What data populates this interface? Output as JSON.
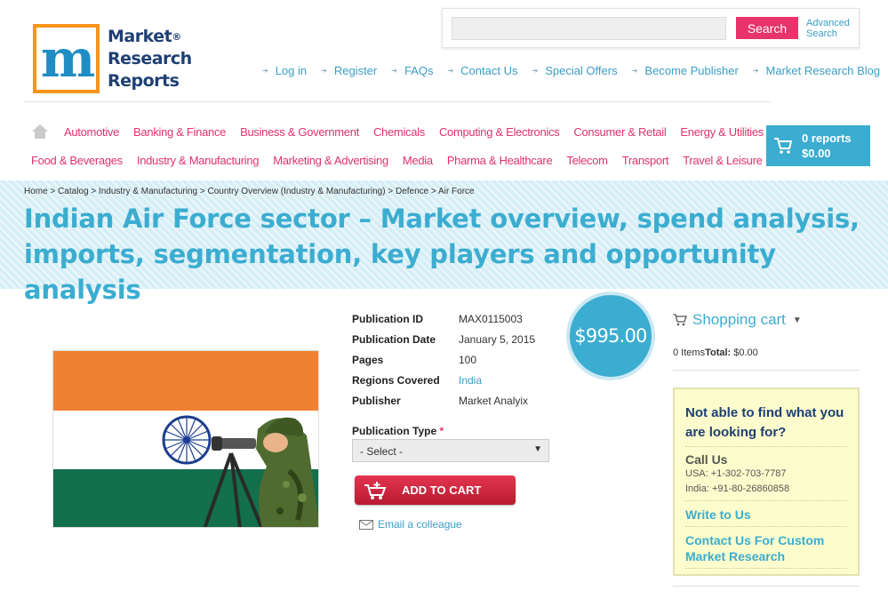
{
  "logo": {
    "text_line1": "Market",
    "text_line2": "Research",
    "text_line3": "Reports",
    "registered": "®"
  },
  "search": {
    "placeholder": "",
    "button_label": "Search",
    "advanced_line1": "Advanced",
    "advanced_line2": "Search"
  },
  "top_links": [
    "Log in",
    "Register",
    "FAQs",
    "Contact Us",
    "Special Offers",
    "Become Publisher",
    "Market Research Blog"
  ],
  "categories": {
    "row1": [
      "Automotive",
      "Banking & Finance",
      "Business & Government",
      "Chemicals",
      "Computing & Electronics",
      "Consumer & Retail",
      "Energy & Utilities"
    ],
    "row2": [
      "Food & Beverages",
      "Industry & Manufacturing",
      "Marketing & Advertising",
      "Media",
      "Pharma & Healthcare",
      "Telecom",
      "Transport",
      "Travel & Leisure"
    ]
  },
  "cart_top": {
    "count": "0 reports",
    "total": "$0.00"
  },
  "breadcrumb": "Home > Catalog > Industry & Manufacturing > Country Overview (Industry & Manufacturing) > Defence > Air Force",
  "title": "Indian Air Force sector – Market overview, spend analysis, imports, segmentation, key players and opportunity analysis",
  "details": [
    {
      "label": "Publication ID",
      "value": "MAX0115003"
    },
    {
      "label": "Publication Date",
      "value": "January 5, 2015"
    },
    {
      "label": "Pages",
      "value": "100"
    },
    {
      "label": "Regions Covered",
      "value": "India"
    },
    {
      "label": "Publisher",
      "value": "Market Analyix"
    }
  ],
  "price": "$995.00",
  "publication_type": {
    "label": "Publication Type",
    "required_mark": "*",
    "selected": "- Select -"
  },
  "add_to_cart": "ADD TO CART",
  "email_colleague": "Email a colleague",
  "shopping_cart": {
    "title": "Shopping cart",
    "items": "0 Items",
    "total_label": "Total:",
    "total_value": "$0.00"
  },
  "help": {
    "question": "Not able to find what you are looking for?",
    "call_us": "Call Us",
    "usa": "USA: +1-302-703-7787",
    "india": "India: +91-80-26860858",
    "write_to_us": "Write to Us",
    "custom_line1": "Contact Us For Custom",
    "custom_line2": "Market Research"
  },
  "colors": {
    "pink": "#e0336a",
    "teal": "#3badd0",
    "navy": "#1e3f74",
    "orange": "#f7941d",
    "flag_saffron": "#f08133",
    "flag_green": "#136f4c"
  }
}
